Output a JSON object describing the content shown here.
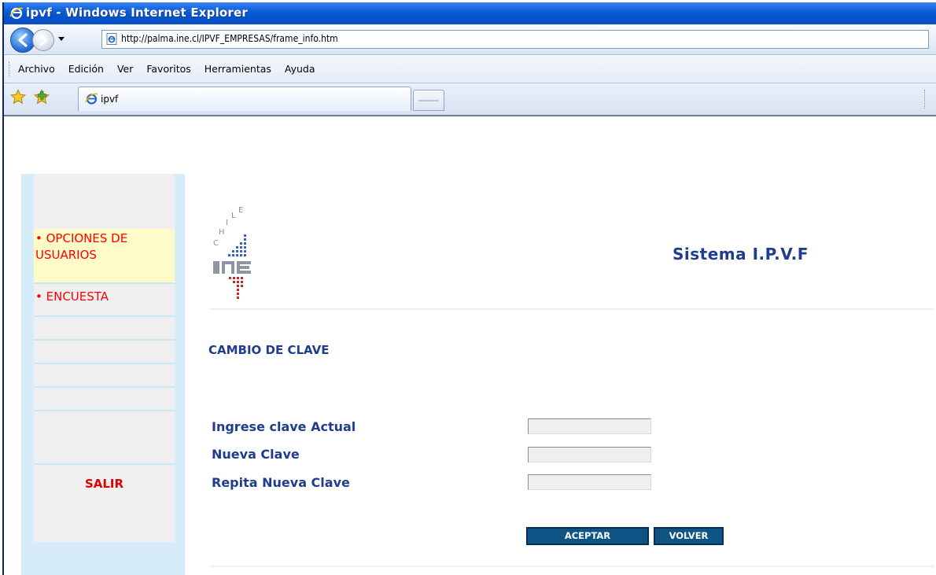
{
  "window": {
    "title": "ipvf - Windows Internet Explorer"
  },
  "addressbar": {
    "url": "http://palma.ine.cl/IPVF_EMPRESAS/frame_info.htm"
  },
  "menubar": {
    "items": [
      "Archivo",
      "Edición",
      "Ver",
      "Favoritos",
      "Herramientas",
      "Ayuda"
    ]
  },
  "tabs": [
    {
      "label": "ipvf"
    }
  ],
  "sidebar": {
    "items": [
      {
        "label": "• OPCIONES DE USUARIOS"
      },
      {
        "label": "• ENCUESTA"
      }
    ],
    "exit_label": "SALIR"
  },
  "header": {
    "system_title": "Sistema I.P.V.F",
    "logo_text": "CHILE INE"
  },
  "form": {
    "section_title": "CAMBIO DE CLAVE",
    "fields": [
      {
        "label": "Ingrese clave Actual",
        "value": ""
      },
      {
        "label": "Nueva Clave",
        "value": ""
      },
      {
        "label": "Repita Nueva Clave",
        "value": ""
      }
    ],
    "accept_label": "ACEPTAR",
    "back_label": "VOLVER"
  },
  "colors": {
    "title_blue": "#1f3d8a",
    "menu_red": "#ff0000",
    "button_blue": "#0e5586",
    "sidebar_blue": "#d7ecf9",
    "sidebar_highlight": "#fffbc9"
  }
}
